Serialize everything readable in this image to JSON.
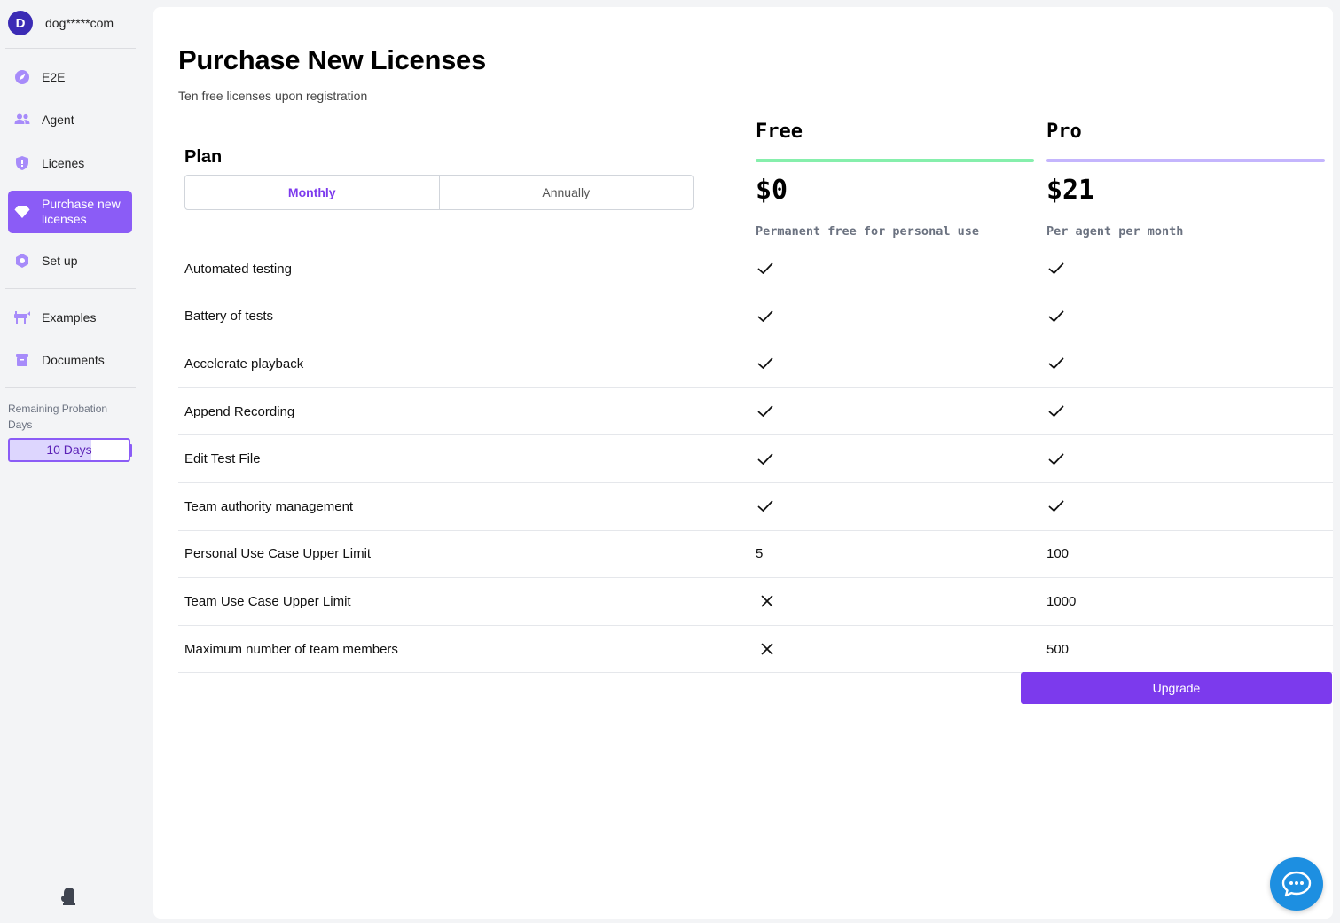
{
  "user": {
    "initial": "D",
    "name": "dog*****com"
  },
  "nav": {
    "items": [
      {
        "label": "E2E",
        "icon": "compass-icon"
      },
      {
        "label": "Agent",
        "icon": "users-icon"
      },
      {
        "label": "Licenes",
        "icon": "shield-icon"
      },
      {
        "label": "Purchase new licenses",
        "icon": "diamond-icon",
        "active": true
      },
      {
        "label": "Set up",
        "icon": "hexagon-gear-icon"
      }
    ],
    "secondary": [
      {
        "label": "Examples",
        "icon": "examples-icon"
      },
      {
        "label": "Documents",
        "icon": "documents-icon"
      }
    ]
  },
  "probation": {
    "label": "Remaining Probation Days",
    "value": "10 Days",
    "fraction": 0.69
  },
  "page": {
    "title": "Purchase New Licenses",
    "subtitle": "Ten free licenses upon registration"
  },
  "plan": {
    "label": "Plan",
    "billing_options": [
      "Monthly",
      "Annually"
    ],
    "selected_billing": "Monthly"
  },
  "plans": [
    {
      "name": "Free",
      "price": "$0",
      "description": "Permanent free for personal use",
      "accent": "#86efac"
    },
    {
      "name": "Pro",
      "price": "$21",
      "description": "Per agent per month",
      "accent": "#c4b5fd"
    }
  ],
  "features": [
    {
      "name": "Automated testing",
      "free": "check",
      "pro": "check"
    },
    {
      "name": "Battery of tests",
      "free": "check",
      "pro": "check"
    },
    {
      "name": "Accelerate playback",
      "free": "check",
      "pro": "check"
    },
    {
      "name": "Append Recording",
      "free": "check",
      "pro": "check"
    },
    {
      "name": "Edit Test File",
      "free": "check",
      "pro": "check"
    },
    {
      "name": "Team authority management",
      "free": "check",
      "pro": "check"
    },
    {
      "name": "Personal Use Case Upper Limit",
      "free": "5",
      "pro": "100"
    },
    {
      "name": "Team Use Case Upper Limit",
      "free": "cross",
      "pro": "1000"
    },
    {
      "name": "Maximum number of team members",
      "free": "cross",
      "pro": "500"
    }
  ],
  "upgrade_label": "Upgrade",
  "colors": {
    "accent": "#7c3aed",
    "sidebar_active": "#8b5cf6",
    "chat": "#1d8fe1"
  }
}
